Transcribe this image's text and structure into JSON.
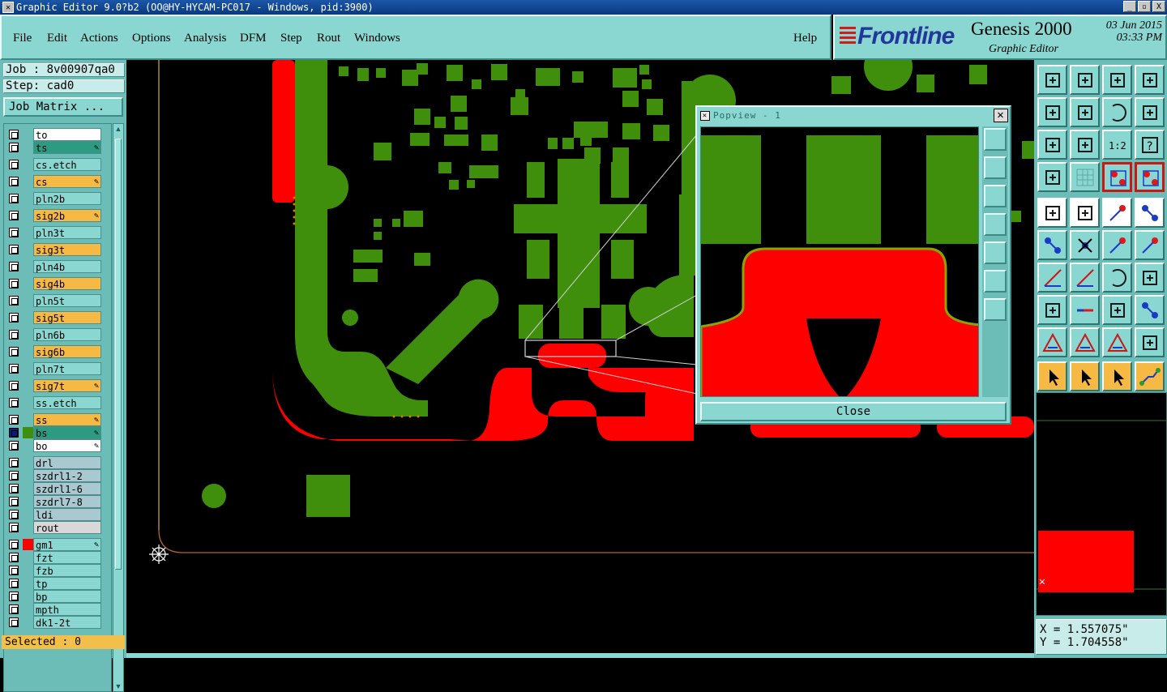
{
  "window": {
    "title": "Graphic Editor 9.0?b2 (OO@HY-HYCAM-PC017 - Windows, pid:3900)",
    "buttons": [
      "_",
      "▫",
      "X"
    ]
  },
  "menu": [
    "File",
    "Edit",
    "Actions",
    "Options",
    "Analysis",
    "DFM",
    "Step",
    "Rout",
    "Windows",
    "Help"
  ],
  "logo": {
    "brand": "Frontline",
    "product": "Genesis 2000",
    "subtitle": "Graphic Editor",
    "date": "03 Jun 2015",
    "time": "03:33 PM"
  },
  "job": {
    "job_label": "Job : 8v00907qa0",
    "step_label": "Step: cad0",
    "matrix_button": "Job Matrix ..."
  },
  "layers": [
    {
      "name": "to",
      "color": "#ffffff",
      "pen": false
    },
    {
      "name": "ts",
      "color": "#2d9b82",
      "pen": true
    },
    {
      "name": "cs.etch",
      "color": "#8ad7d2",
      "pen": false
    },
    {
      "name": "cs",
      "color": "#f6b944",
      "pen": true
    },
    {
      "name": "pln2b",
      "color": "#8ad7d2",
      "pen": false
    },
    {
      "name": "sig2b",
      "color": "#f6b944",
      "pen": true
    },
    {
      "name": "pln3t",
      "color": "#8ad7d2",
      "pen": false
    },
    {
      "name": "sig3t",
      "color": "#f6b944",
      "pen": false
    },
    {
      "name": "pln4b",
      "color": "#8ad7d2",
      "pen": false
    },
    {
      "name": "sig4b",
      "color": "#f6b944",
      "pen": false
    },
    {
      "name": "pln5t",
      "color": "#8ad7d2",
      "pen": false
    },
    {
      "name": "sig5t",
      "color": "#f6b944",
      "pen": false
    },
    {
      "name": "pln6b",
      "color": "#8ad7d2",
      "pen": false
    },
    {
      "name": "sig6b",
      "color": "#f6b944",
      "pen": false
    },
    {
      "name": "pln7t",
      "color": "#8ad7d2",
      "pen": false
    },
    {
      "name": "sig7t",
      "color": "#f6b944",
      "pen": true
    },
    {
      "name": "ss.etch",
      "color": "#8ad7d2",
      "pen": false
    },
    {
      "name": "ss",
      "color": "#f6b944",
      "pen": true
    },
    {
      "name": "bs",
      "color": "#2d9b82",
      "pen": true
    },
    {
      "name": "bo",
      "color": "#ffffff",
      "pen": true
    },
    {
      "name": "drl",
      "color": "#a9c8d0",
      "pen": false
    },
    {
      "name": "szdrl1-2",
      "color": "#a9c8d0",
      "pen": false
    },
    {
      "name": "szdrl1-6",
      "color": "#a9c8d0",
      "pen": false
    },
    {
      "name": "szdrl7-8",
      "color": "#a9c8d0",
      "pen": false
    },
    {
      "name": "ldi",
      "color": "#a9c8d0",
      "pen": false
    },
    {
      "name": "rout",
      "color": "#d8d8d8",
      "pen": false
    },
    {
      "name": "gm1",
      "color": "#8ad7d2",
      "pen": true
    },
    {
      "name": "fzt",
      "color": "#8ad7d2",
      "pen": false
    },
    {
      "name": "fzb",
      "color": "#8ad7d2",
      "pen": false
    },
    {
      "name": "tp",
      "color": "#8ad7d2",
      "pen": false
    },
    {
      "name": "bp",
      "color": "#8ad7d2",
      "pen": false
    },
    {
      "name": "mpth",
      "color": "#8ad7d2",
      "pen": false
    },
    {
      "name": "dk1-2t",
      "color": "#8ad7d2",
      "pen": false
    }
  ],
  "status": {
    "selected": "Selected : 0"
  },
  "popview": {
    "title": "Popview - 1",
    "close_label": "Close"
  },
  "coords": {
    "x": "X = 1.557075\"",
    "y": "Y = 1.704558\""
  },
  "toolbar": [
    "home-view-icon",
    "zoom-in-icon",
    "house-icon",
    "window-icon",
    "pan-left-icon",
    "pan-right-icon",
    "rotate-icon",
    "flip-icon",
    "fit-icon",
    "center-icon",
    "scale-1-2-icon",
    "help-icon",
    "ruler-tool-icon",
    "grid-icon",
    "snap-red-icon",
    "snap-red2-icon",
    "add-feature-icon",
    "select-icon",
    "measure-icon",
    "pad-icon",
    "node-edit-icon",
    "delete-icon",
    "move-icon",
    "copy-icon",
    "draw-line-icon",
    "slash-icon",
    "arc-icon",
    "text-icon",
    "connect-icon",
    "minus-icon",
    "resize-icon",
    "group-icon",
    "warning-icon",
    "angle-icon",
    "arch-icon",
    "scale-icon",
    "pointer-icon",
    "pointer-box-icon",
    "pointer-select-icon",
    "route-icon"
  ],
  "colors": {
    "copper": "#3f8f0c",
    "red_layer": "#ff0000",
    "panel": "#8ad7d2",
    "highlight": "#f6b944"
  }
}
